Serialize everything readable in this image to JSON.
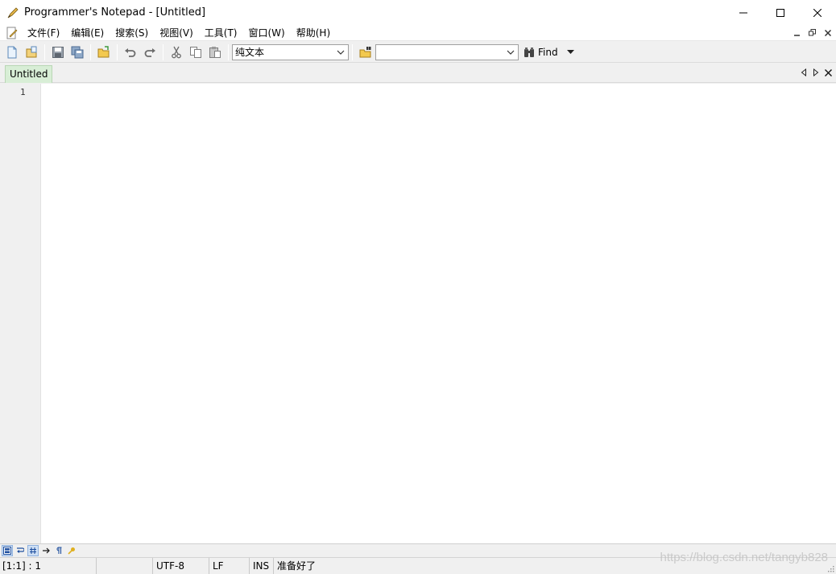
{
  "window": {
    "title": "Programmer's Notepad - [Untitled]"
  },
  "menu": {
    "items": [
      {
        "label": "文件(F)",
        "key": "file"
      },
      {
        "label": "编辑(E)",
        "key": "edit"
      },
      {
        "label": "搜索(S)",
        "key": "search"
      },
      {
        "label": "视图(V)",
        "key": "view"
      },
      {
        "label": "工具(T)",
        "key": "tools"
      },
      {
        "label": "窗口(W)",
        "key": "window"
      },
      {
        "label": "帮助(H)",
        "key": "help"
      }
    ]
  },
  "toolbar": {
    "scheme_value": "纯文本",
    "search_value": "",
    "find_label": "Find"
  },
  "tabs": [
    {
      "label": "Untitled"
    }
  ],
  "editor": {
    "line_numbers": [
      "1"
    ]
  },
  "status": {
    "position": "[1:1] : 1",
    "encoding": "UTF-8",
    "line_ending": "LF",
    "insert_mode": "INS",
    "message": "准备好了"
  },
  "watermark": "https://blog.csdn.net/tangyb828",
  "colors": {
    "tab_active": "#d8eed6",
    "editor_bg": "#ffffff",
    "chrome_bg": "#f0f0f0"
  }
}
